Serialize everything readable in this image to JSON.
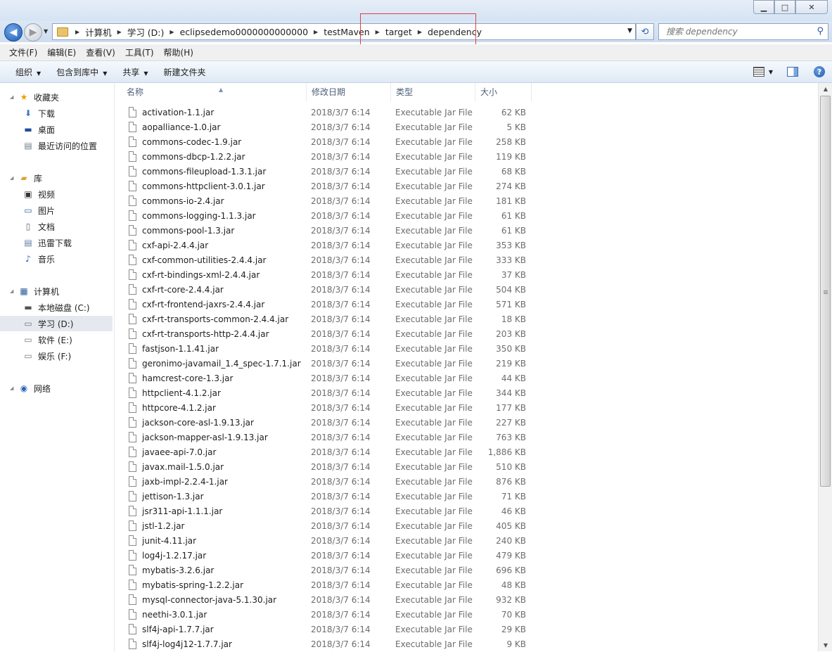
{
  "window": {
    "minimize": "▁",
    "maximize": "□",
    "close": "✕"
  },
  "address": {
    "crumbs": [
      "计算机",
      "学习 (D:)",
      "eclipsedemo0000000000000",
      "testMaven",
      "target",
      "dependency"
    ]
  },
  "search": {
    "placeholder": "搜索 dependency"
  },
  "menu": [
    "文件(F)",
    "编辑(E)",
    "查看(V)",
    "工具(T)",
    "帮助(H)"
  ],
  "toolbar": {
    "organize": "组织",
    "include_library": "包含到库中",
    "share": "共享",
    "new_folder": "新建文件夹"
  },
  "nav": {
    "favorites": {
      "label": "收藏夹",
      "items": [
        "下载",
        "桌面",
        "最近访问的位置"
      ]
    },
    "libraries": {
      "label": "库",
      "items": [
        "视频",
        "图片",
        "文档",
        "迅雷下载",
        "音乐"
      ]
    },
    "computer": {
      "label": "计算机",
      "items": [
        "本地磁盘 (C:)",
        "学习 (D:)",
        "软件 (E:)",
        "娱乐 (F:)"
      ]
    },
    "network": {
      "label": "网络"
    }
  },
  "columns": {
    "name": "名称",
    "date": "修改日期",
    "type": "类型",
    "size": "大小"
  },
  "files": [
    {
      "name": "activation-1.1.jar",
      "date": "2018/3/7 6:14",
      "type": "Executable Jar File",
      "size": "62 KB"
    },
    {
      "name": "aopalliance-1.0.jar",
      "date": "2018/3/7 6:14",
      "type": "Executable Jar File",
      "size": "5 KB"
    },
    {
      "name": "commons-codec-1.9.jar",
      "date": "2018/3/7 6:14",
      "type": "Executable Jar File",
      "size": "258 KB"
    },
    {
      "name": "commons-dbcp-1.2.2.jar",
      "date": "2018/3/7 6:14",
      "type": "Executable Jar File",
      "size": "119 KB"
    },
    {
      "name": "commons-fileupload-1.3.1.jar",
      "date": "2018/3/7 6:14",
      "type": "Executable Jar File",
      "size": "68 KB"
    },
    {
      "name": "commons-httpclient-3.0.1.jar",
      "date": "2018/3/7 6:14",
      "type": "Executable Jar File",
      "size": "274 KB"
    },
    {
      "name": "commons-io-2.4.jar",
      "date": "2018/3/7 6:14",
      "type": "Executable Jar File",
      "size": "181 KB"
    },
    {
      "name": "commons-logging-1.1.3.jar",
      "date": "2018/3/7 6:14",
      "type": "Executable Jar File",
      "size": "61 KB"
    },
    {
      "name": "commons-pool-1.3.jar",
      "date": "2018/3/7 6:14",
      "type": "Executable Jar File",
      "size": "61 KB"
    },
    {
      "name": "cxf-api-2.4.4.jar",
      "date": "2018/3/7 6:14",
      "type": "Executable Jar File",
      "size": "353 KB"
    },
    {
      "name": "cxf-common-utilities-2.4.4.jar",
      "date": "2018/3/7 6:14",
      "type": "Executable Jar File",
      "size": "333 KB"
    },
    {
      "name": "cxf-rt-bindings-xml-2.4.4.jar",
      "date": "2018/3/7 6:14",
      "type": "Executable Jar File",
      "size": "37 KB"
    },
    {
      "name": "cxf-rt-core-2.4.4.jar",
      "date": "2018/3/7 6:14",
      "type": "Executable Jar File",
      "size": "504 KB"
    },
    {
      "name": "cxf-rt-frontend-jaxrs-2.4.4.jar",
      "date": "2018/3/7 6:14",
      "type": "Executable Jar File",
      "size": "571 KB"
    },
    {
      "name": "cxf-rt-transports-common-2.4.4.jar",
      "date": "2018/3/7 6:14",
      "type": "Executable Jar File",
      "size": "18 KB"
    },
    {
      "name": "cxf-rt-transports-http-2.4.4.jar",
      "date": "2018/3/7 6:14",
      "type": "Executable Jar File",
      "size": "203 KB"
    },
    {
      "name": "fastjson-1.1.41.jar",
      "date": "2018/3/7 6:14",
      "type": "Executable Jar File",
      "size": "350 KB"
    },
    {
      "name": "geronimo-javamail_1.4_spec-1.7.1.jar",
      "date": "2018/3/7 6:14",
      "type": "Executable Jar File",
      "size": "219 KB"
    },
    {
      "name": "hamcrest-core-1.3.jar",
      "date": "2018/3/7 6:14",
      "type": "Executable Jar File",
      "size": "44 KB"
    },
    {
      "name": "httpclient-4.1.2.jar",
      "date": "2018/3/7 6:14",
      "type": "Executable Jar File",
      "size": "344 KB"
    },
    {
      "name": "httpcore-4.1.2.jar",
      "date": "2018/3/7 6:14",
      "type": "Executable Jar File",
      "size": "177 KB"
    },
    {
      "name": "jackson-core-asl-1.9.13.jar",
      "date": "2018/3/7 6:14",
      "type": "Executable Jar File",
      "size": "227 KB"
    },
    {
      "name": "jackson-mapper-asl-1.9.13.jar",
      "date": "2018/3/7 6:14",
      "type": "Executable Jar File",
      "size": "763 KB"
    },
    {
      "name": "javaee-api-7.0.jar",
      "date": "2018/3/7 6:14",
      "type": "Executable Jar File",
      "size": "1,886 KB"
    },
    {
      "name": "javax.mail-1.5.0.jar",
      "date": "2018/3/7 6:14",
      "type": "Executable Jar File",
      "size": "510 KB"
    },
    {
      "name": "jaxb-impl-2.2.4-1.jar",
      "date": "2018/3/7 6:14",
      "type": "Executable Jar File",
      "size": "876 KB"
    },
    {
      "name": "jettison-1.3.jar",
      "date": "2018/3/7 6:14",
      "type": "Executable Jar File",
      "size": "71 KB"
    },
    {
      "name": "jsr311-api-1.1.1.jar",
      "date": "2018/3/7 6:14",
      "type": "Executable Jar File",
      "size": "46 KB"
    },
    {
      "name": "jstl-1.2.jar",
      "date": "2018/3/7 6:14",
      "type": "Executable Jar File",
      "size": "405 KB"
    },
    {
      "name": "junit-4.11.jar",
      "date": "2018/3/7 6:14",
      "type": "Executable Jar File",
      "size": "240 KB"
    },
    {
      "name": "log4j-1.2.17.jar",
      "date": "2018/3/7 6:14",
      "type": "Executable Jar File",
      "size": "479 KB"
    },
    {
      "name": "mybatis-3.2.6.jar",
      "date": "2018/3/7 6:14",
      "type": "Executable Jar File",
      "size": "696 KB"
    },
    {
      "name": "mybatis-spring-1.2.2.jar",
      "date": "2018/3/7 6:14",
      "type": "Executable Jar File",
      "size": "48 KB"
    },
    {
      "name": "mysql-connector-java-5.1.30.jar",
      "date": "2018/3/7 6:14",
      "type": "Executable Jar File",
      "size": "932 KB"
    },
    {
      "name": "neethi-3.0.1.jar",
      "date": "2018/3/7 6:14",
      "type": "Executable Jar File",
      "size": "70 KB"
    },
    {
      "name": "slf4j-api-1.7.7.jar",
      "date": "2018/3/7 6:14",
      "type": "Executable Jar File",
      "size": "29 KB"
    },
    {
      "name": "slf4j-log4j12-1.7.7.jar",
      "date": "2018/3/7 6:14",
      "type": "Executable Jar File",
      "size": "9 KB"
    }
  ],
  "colors": {
    "highlight_box": "#e04040",
    "selected_nav": "#e5e9ef",
    "header_text": "#4c607a"
  }
}
